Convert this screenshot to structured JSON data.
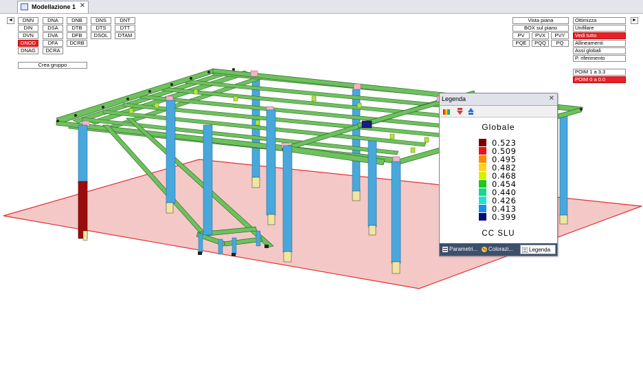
{
  "tab": {
    "title": "Modellazione 1",
    "close": "✕",
    "icon": "model-grid-icon"
  },
  "nav": {
    "left": "◄",
    "right": "►"
  },
  "filter_buttons": [
    [
      "DNN",
      "DNA",
      "DNB",
      "DNS",
      "DNT"
    ],
    [
      "DIN",
      "DSA",
      "DTB",
      "DTS",
      "DTT"
    ],
    [
      "DVN",
      "DVA",
      "DFB",
      "DSOL",
      "DTAM"
    ],
    [
      "DNOD",
      "DFA",
      "DCRB"
    ],
    [
      "DNAG",
      "DCRA"
    ]
  ],
  "crea_gruppo": "Crea  gruppo",
  "view_buttons": {
    "vista_piana": "Vista  piana",
    "box_sul_piano": "BOX  sul  piano",
    "row1": [
      "PV",
      "PVX",
      "PVY"
    ],
    "row2": [
      "PQE",
      "PQQ",
      "PQ"
    ]
  },
  "right_buttons": [
    "Ottimizza",
    "Unifilare",
    "Vedi  tutto",
    "Allineamenti",
    "Assi  globali",
    "P.  riferimento"
  ],
  "poim": [
    "POIM    1  a  3.3",
    "POIM    0  a  0.0"
  ],
  "legend": {
    "title": "Legenda",
    "close": "✕",
    "heading": "Globale",
    "scale": [
      {
        "value": "0.523",
        "color": "#7a0000"
      },
      {
        "value": "0.509",
        "color": "#e8141b"
      },
      {
        "value": "0.495",
        "color": "#ff8a00"
      },
      {
        "value": "0.482",
        "color": "#ffd21a"
      },
      {
        "value": "0.468",
        "color": "#d8f000"
      },
      {
        "value": "0.454",
        "color": "#22c61c"
      },
      {
        "value": "0.440",
        "color": "#14d98a"
      },
      {
        "value": "0.426",
        "color": "#1fe3d2"
      },
      {
        "value": "0.413",
        "color": "#1b8ee8"
      },
      {
        "value": "0.399",
        "color": "#0a0a78"
      }
    ],
    "footer": "CC  SLU",
    "tabs": [
      "Parametri...",
      "Colorazi...",
      "Legenda"
    ]
  },
  "colors": {
    "beam": "#6ec15e",
    "column": "#48a8dc",
    "column_critical": "#9b0d0d",
    "base_plate": "#f0e6a0",
    "ground_fill": "#f5c8c8",
    "ground_edge": "#e03030",
    "active_button": "#ee1f24"
  }
}
